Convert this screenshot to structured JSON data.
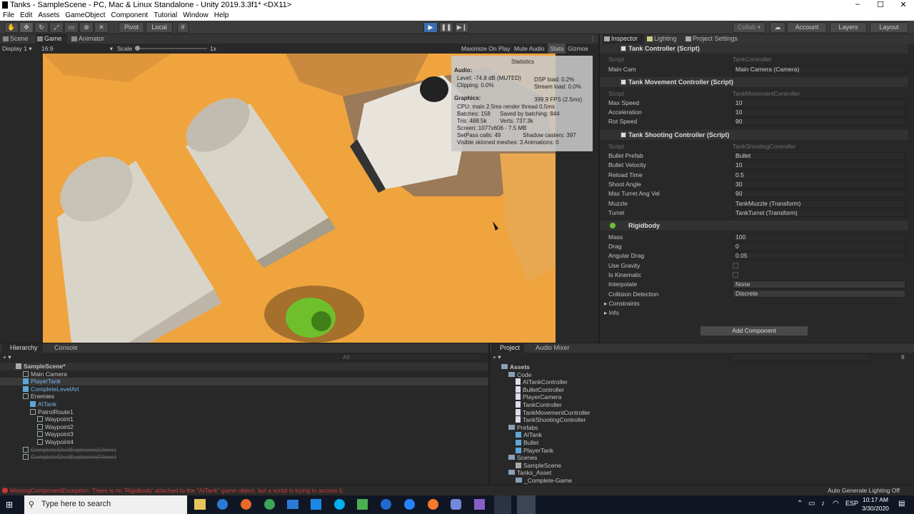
{
  "window": {
    "title": "Tanks - SampleScene - PC, Mac & Linux Standalone - Unity 2019.3.3f1* <DX11>",
    "minimize": "–",
    "maximize": "☐",
    "close": "✕"
  },
  "menu": [
    "File",
    "Edit",
    "Assets",
    "GameObject",
    "Component",
    "Tutorial",
    "Window",
    "Help"
  ],
  "toolbar": {
    "pivot": "Pivot",
    "local": "Local",
    "collab": "Collab ▾",
    "account": "Account",
    "layers": "Layers",
    "layout": "Layout"
  },
  "game": {
    "tabs": [
      "Scene",
      "Game",
      "Animator"
    ],
    "display": "Display 1",
    "aspect": "16:9",
    "scale_label": "Scale",
    "scale_value": "1x",
    "maximize": "Maximize On Play",
    "mute": "Mute Audio",
    "stats": "Stats",
    "gizmos": "Gizmos"
  },
  "stats": {
    "title": "Statistics",
    "audio_h": "Audio:",
    "level": "Level: -74.8 dB (MUTED)",
    "clipping": "Clipping: 0.0%",
    "dsp": "DSP load: 0.2%",
    "stream": "Stream load: 0.0%",
    "graphics_h": "Graphics:",
    "fps": "399.9 FPS (2.5ms)",
    "cpu": "CPU: main 2.5ms  render thread 0.5ms",
    "batches": "Batches: 158",
    "saved": "Saved by batching: 844",
    "tris": "Tris: 488.5k",
    "verts": "Verts: 737.3k",
    "screen": "Screen: 1077x606 - 7.5 MB",
    "setpass": "SetPass calls: 49",
    "shadow": "Shadow casters: 397",
    "skinned": "Visible skinned meshes: 3  Animations: 0"
  },
  "inspector": {
    "tabs": [
      "Inspector",
      "Lighting",
      "Project Settings"
    ],
    "tank_controller": {
      "title": "Tank Controller (Script)",
      "script_label": "Script",
      "script_value": "TankController",
      "main_cam_label": "Main Cam",
      "main_cam_value": "Main Camera (Camera)"
    },
    "movement": {
      "title": "Tank Movement Controller (Script)",
      "script_label": "Script",
      "script_value": "TankMovementController",
      "fields": [
        {
          "label": "Max Speed",
          "value": "10"
        },
        {
          "label": "Acceleration",
          "value": "10"
        },
        {
          "label": "Rot Speed",
          "value": "90"
        }
      ]
    },
    "shooting": {
      "title": "Tank Shooting Controller (Script)",
      "script_label": "Script",
      "script_value": "TankShootingController",
      "fields": [
        {
          "label": "Bullet Prefab",
          "value": "Bullet"
        },
        {
          "label": "Bullet Velocity",
          "value": "10"
        },
        {
          "label": "Reload Time",
          "value": "0.5"
        },
        {
          "label": "Shoot Angle",
          "value": "30"
        },
        {
          "label": "Max Turret Ang Vel",
          "value": "90"
        },
        {
          "label": "Muzzle",
          "value": "TankMuzzle (Transform)"
        },
        {
          "label": "Turret",
          "value": "TankTurret (Transform)"
        }
      ]
    },
    "rigidbody": {
      "title": "Rigidbody",
      "fields": [
        {
          "label": "Mass",
          "value": "100"
        },
        {
          "label": "Drag",
          "value": "0"
        },
        {
          "label": "Angular Drag",
          "value": "0.05"
        }
      ],
      "use_gravity": "Use Gravity",
      "is_kinematic": "Is Kinematic",
      "interpolate_label": "Interpolate",
      "interpolate_value": "None",
      "collision_label": "Collision Detection",
      "collision_value": "Discrete",
      "constraints": "Constraints",
      "info": "Info"
    },
    "add_component": "Add Component"
  },
  "hierarchy": {
    "tabs": [
      "Hierarchy",
      "Console"
    ],
    "search": "All",
    "items": [
      {
        "label": "SampleScene*",
        "indent": 0,
        "kind": "scene"
      },
      {
        "label": "Main Camera",
        "indent": 1,
        "kind": "go"
      },
      {
        "label": "PlayerTank",
        "indent": 1,
        "kind": "prefab"
      },
      {
        "label": "CompleteLevelArt",
        "indent": 1,
        "kind": "prefab"
      },
      {
        "label": "Enemies",
        "indent": 1,
        "kind": "go"
      },
      {
        "label": "AITank",
        "indent": 2,
        "kind": "prefab"
      },
      {
        "label": "PatrolRoute1",
        "indent": 2,
        "kind": "go"
      },
      {
        "label": "Waypoint1",
        "indent": 3,
        "kind": "go"
      },
      {
        "label": "Waypoint2",
        "indent": 3,
        "kind": "go"
      },
      {
        "label": "Waypoint3",
        "indent": 3,
        "kind": "go"
      },
      {
        "label": "Waypoint4",
        "indent": 3,
        "kind": "go"
      },
      {
        "label": "CompleteShellExplosion(Clone)",
        "indent": 1,
        "kind": "ghost"
      },
      {
        "label": "CompleteShellExplosion(Clone)",
        "indent": 1,
        "kind": "ghost"
      }
    ]
  },
  "project": {
    "tabs": [
      "Project",
      "Audio Mixer"
    ],
    "count": "8",
    "items": [
      {
        "label": "Assets",
        "indent": 0,
        "kind": "folder"
      },
      {
        "label": "Code",
        "indent": 1,
        "kind": "folder"
      },
      {
        "label": "AITankController",
        "indent": 2,
        "kind": "cs"
      },
      {
        "label": "BulletController",
        "indent": 2,
        "kind": "cs"
      },
      {
        "label": "PlayerCamera",
        "indent": 2,
        "kind": "cs"
      },
      {
        "label": "TankController",
        "indent": 2,
        "kind": "cs"
      },
      {
        "label": "TankMovementController",
        "indent": 2,
        "kind": "cs"
      },
      {
        "label": "TankShootingController",
        "indent": 2,
        "kind": "cs"
      },
      {
        "label": "Prefabs",
        "indent": 1,
        "kind": "folder"
      },
      {
        "label": "AITank",
        "indent": 2,
        "kind": "prefab"
      },
      {
        "label": "Bullet",
        "indent": 2,
        "kind": "prefab"
      },
      {
        "label": "PlayerTank",
        "indent": 2,
        "kind": "prefab"
      },
      {
        "label": "Scenes",
        "indent": 1,
        "kind": "folder"
      },
      {
        "label": "SampleScene",
        "indent": 2,
        "kind": "scene"
      },
      {
        "label": "Tanks_Asset",
        "indent": 1,
        "kind": "folder"
      },
      {
        "label": "_Complete-Game",
        "indent": 2,
        "kind": "folder"
      }
    ]
  },
  "status": {
    "error": "MissingComponentException: There is no 'Rigidbody' attached to the \"AITank\" game object, but a script is trying to access it.",
    "lighting": "Auto Generate Lighting Off"
  },
  "taskbar": {
    "search": "Type here to search",
    "lang": "ESP",
    "time": "10:17 AM",
    "date": "3/30/2020"
  }
}
